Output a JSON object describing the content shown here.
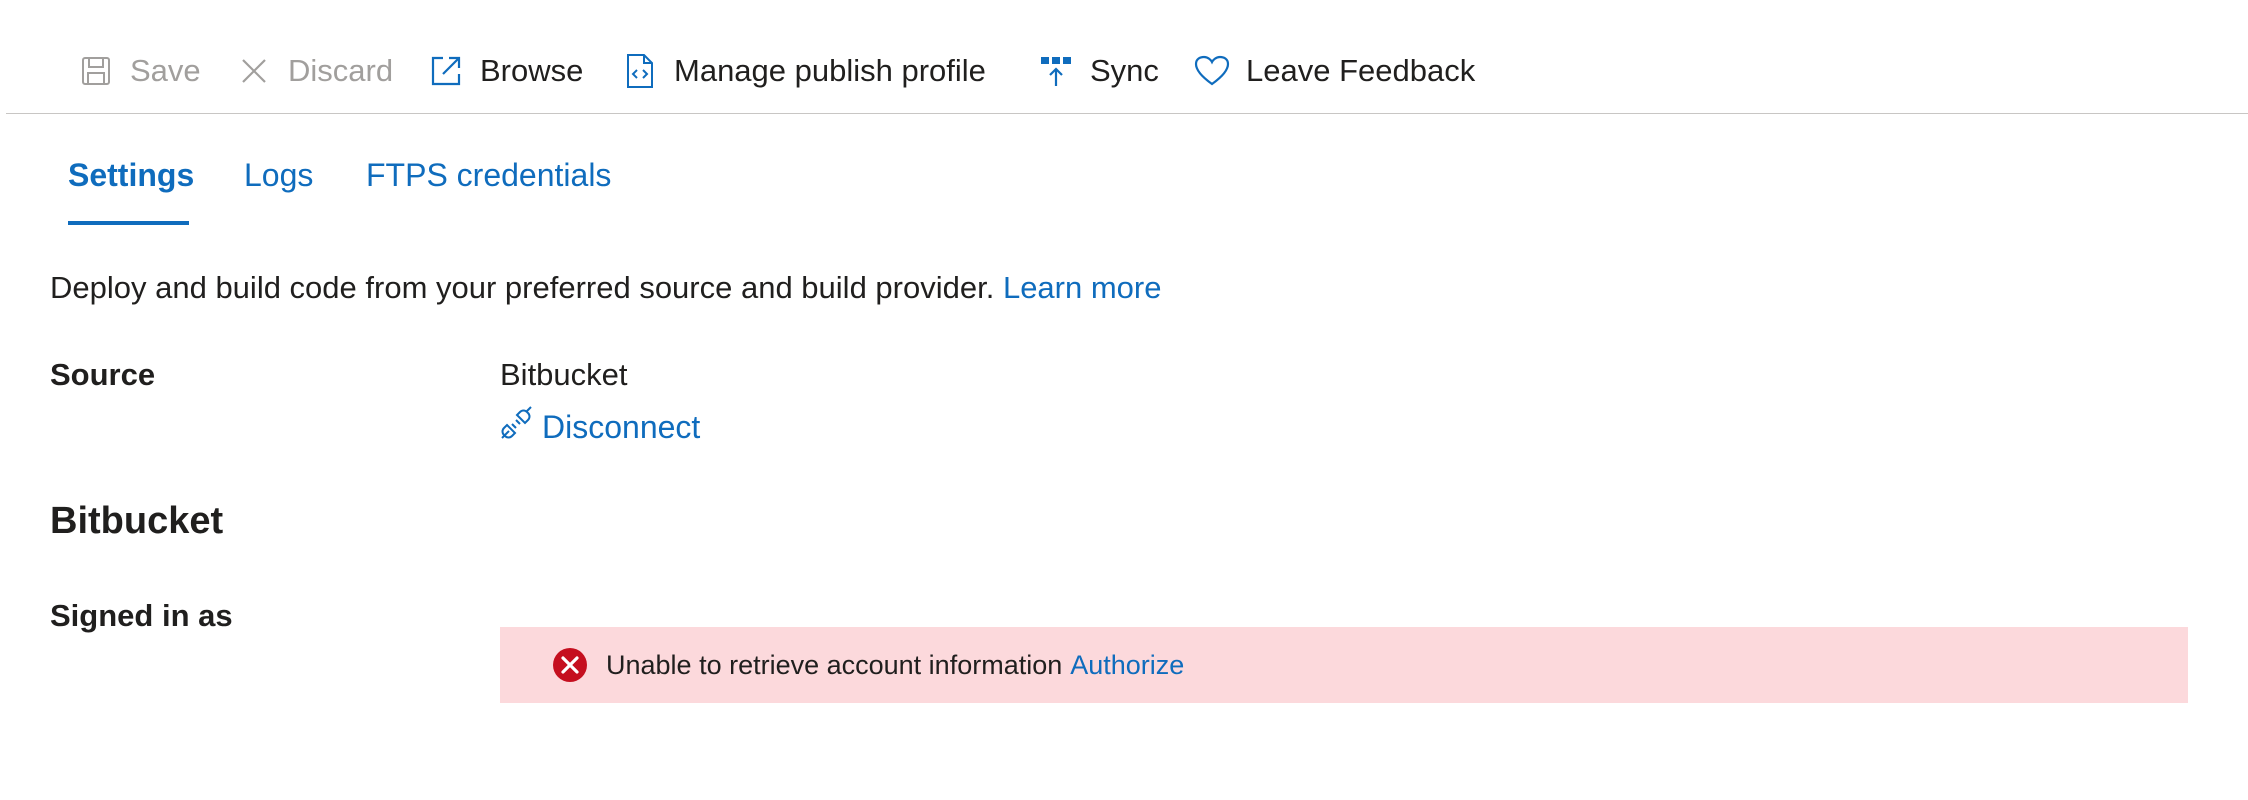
{
  "toolbar": {
    "save_label": "Save",
    "discard_label": "Discard",
    "browse_label": "Browse",
    "manage_publish_profile_label": "Manage publish profile",
    "sync_label": "Sync",
    "feedback_label": "Leave Feedback"
  },
  "tabs": [
    {
      "label": "Settings",
      "active": true
    },
    {
      "label": "Logs",
      "active": false
    },
    {
      "label": "FTPS credentials",
      "active": false
    }
  ],
  "description": {
    "text": "Deploy and build code from your preferred source and build provider.",
    "link": "Learn more"
  },
  "source": {
    "label": "Source",
    "value": "Bitbucket",
    "disconnect_label": "Disconnect"
  },
  "bitbucket_section": {
    "heading": "Bitbucket",
    "signed_in_label": "Signed in as",
    "error_message": "Unable to retrieve account information",
    "authorize_link": "Authorize"
  },
  "colors": {
    "accent": "#0f6cbd",
    "error_bg": "#fcd9dc",
    "error_icon": "#c50f1f",
    "disabled_text": "#a19f9d"
  },
  "icons": {
    "save": "save-icon",
    "discard": "close-icon",
    "browse": "open-external-icon",
    "manage": "code-file-icon",
    "sync": "sync-icon",
    "feedback": "heart-icon",
    "disconnect": "plug-disconnect-icon",
    "error": "error-circle-icon"
  }
}
